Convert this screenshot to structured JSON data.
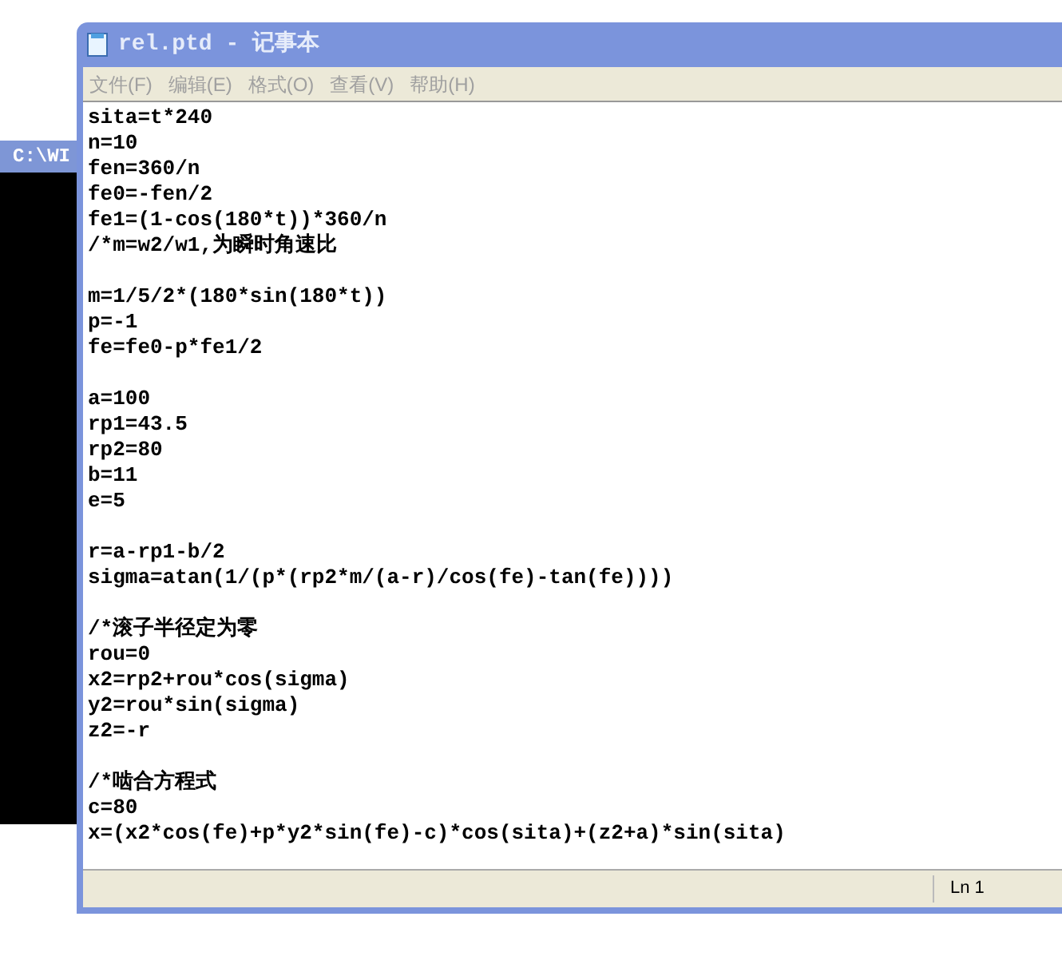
{
  "console_window": {
    "title": "C:\\WI"
  },
  "notepad": {
    "title": "rel.ptd - 记事本",
    "menu": [
      {
        "label": "文件(F)",
        "disabled": true
      },
      {
        "label": "编辑(E)",
        "disabled": true
      },
      {
        "label": "格式(O)",
        "disabled": true
      },
      {
        "label": "查看(V)",
        "disabled": true
      },
      {
        "label": "帮助(H)",
        "disabled": true
      }
    ],
    "text_blocks": [
      [
        "sita=t*240",
        "n=10",
        "fen=360/n",
        "fe0=-fen/2",
        "fe1=(1-cos(180*t))*360/n",
        "/*m=w2/w1,为瞬时角速比"
      ],
      [
        "m=1/5/2*(180*sin(180*t))",
        "p=-1",
        "fe=fe0-p*fe1/2"
      ],
      [
        "a=100",
        "rp1=43.5",
        "rp2=80",
        "b=11",
        "e=5"
      ],
      [
        "r=a-rp1-b/2",
        "sigma=atan(1/(p*(rp2*m/(a-r)/cos(fe)-tan(fe))))"
      ],
      [
        "/*滚子半径定为零",
        "rou=0",
        "x2=rp2+rou*cos(sigma)",
        "y2=rou*sin(sigma)",
        "z2=-r"
      ],
      [
        "/*啮合方程式",
        "c=80",
        "x=(x2*cos(fe)+p*y2*sin(fe)-c)*cos(sita)+(z2+a)*sin(sita)"
      ]
    ],
    "status_bar": {
      "position": "Ln 1"
    }
  }
}
